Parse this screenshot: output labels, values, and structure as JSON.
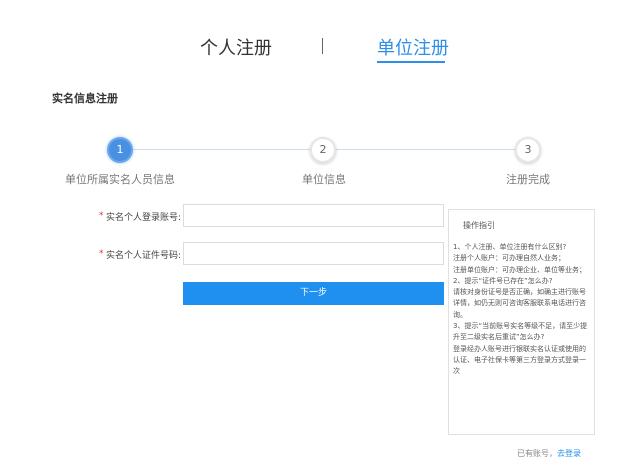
{
  "tabs": {
    "personal": "个人注册",
    "unit": "单位注册"
  },
  "section_title": "实名信息注册",
  "steps": [
    {
      "number": "1",
      "label": "单位所属实名人员信息"
    },
    {
      "number": "2",
      "label": "单位信息"
    },
    {
      "number": "3",
      "label": "注册完成"
    }
  ],
  "form": {
    "required_mark": "*",
    "account_label": "实名个人登录账号:",
    "account_value": "",
    "id_label": "实名个人证件号码:",
    "id_value": "",
    "next_label": "下一步"
  },
  "guide": {
    "title": "操作指引",
    "lines": [
      "1、个人注册、单位注册有什么区别?",
      "注册个人账户：可办理自然人业务；",
      "注册单位账户：可办理企业、单位等业务；",
      "2、提示“证件号已存在”怎么办?",
      "请核对身份证号是否正确，如确主进行账号",
      "详情，如仍无则可咨询客服联系电话进行咨",
      "询。",
      "3、提示“当前账号实名等级不足，请至少提",
      "升至二级实名后重试”怎么办?",
      "登录经办人账号进行银联实名认证或使用的",
      "认证、电子社保卡等第三方登录方式登录一",
      "次"
    ]
  },
  "login": {
    "prompt": "已有账号，",
    "link": "去登录"
  },
  "colors": {
    "accent": "#2f8fe8",
    "button": "#1f8ff0",
    "required": "#e33333"
  }
}
